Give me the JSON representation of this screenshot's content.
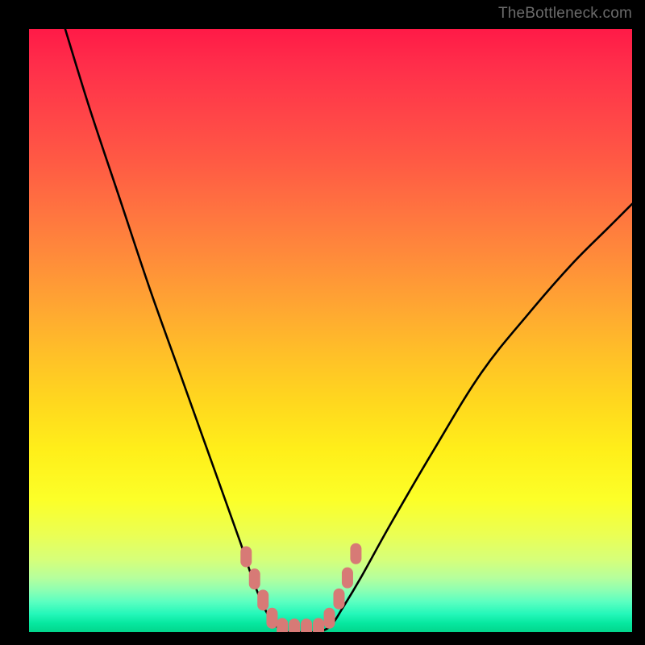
{
  "watermark": "TheBottleneck.com",
  "chart_data": {
    "type": "line",
    "title": "",
    "xlabel": "",
    "ylabel": "",
    "xlim": [
      0,
      100
    ],
    "ylim": [
      0,
      100
    ],
    "grid": false,
    "legend": false,
    "series": [
      {
        "name": "left-curve",
        "x": [
          6,
          10,
          15,
          20,
          25,
          30,
          35,
          37,
          39,
          41,
          42
        ],
        "y": [
          100,
          87,
          72,
          57,
          43,
          29,
          15,
          9,
          4,
          1,
          0
        ]
      },
      {
        "name": "right-curve",
        "x": [
          48,
          50,
          52,
          55,
          60,
          67,
          75,
          83,
          90,
          96,
          100
        ],
        "y": [
          0,
          1,
          4,
          9,
          18,
          30,
          43,
          53,
          61,
          67,
          71
        ]
      },
      {
        "name": "valley-floor",
        "x": [
          42,
          48
        ],
        "y": [
          0,
          0
        ]
      }
    ],
    "markers": {
      "name": "pink-markers",
      "color": "#d77a76",
      "points": [
        {
          "x": 36.0,
          "y": 12.5
        },
        {
          "x": 37.4,
          "y": 8.8
        },
        {
          "x": 38.8,
          "y": 5.3
        },
        {
          "x": 40.3,
          "y": 2.3
        },
        {
          "x": 42.0,
          "y": 0.6
        },
        {
          "x": 44.0,
          "y": 0.5
        },
        {
          "x": 46.0,
          "y": 0.5
        },
        {
          "x": 48.0,
          "y": 0.6
        },
        {
          "x": 49.8,
          "y": 2.3
        },
        {
          "x": 51.4,
          "y": 5.5
        },
        {
          "x": 52.8,
          "y": 9.0
        },
        {
          "x": 54.2,
          "y": 13.0
        }
      ]
    },
    "background_gradient": {
      "top": "#ff1a47",
      "mid": "#ffe11e",
      "bottom": "#02d68c"
    }
  }
}
